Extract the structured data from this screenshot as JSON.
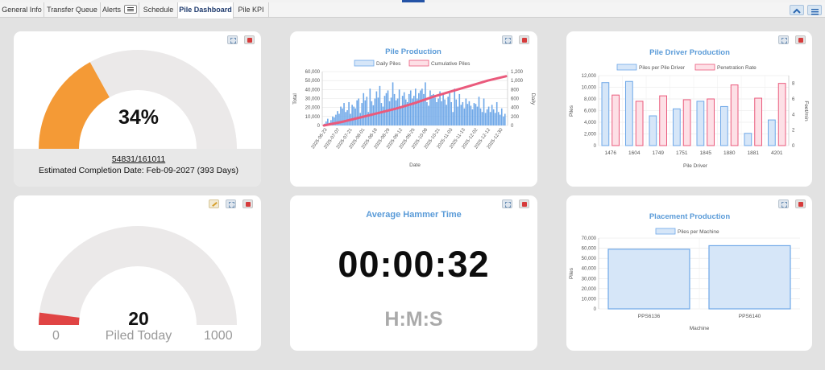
{
  "tabs": [
    {
      "label": "General Info",
      "active": false
    },
    {
      "label": "Transfer Queue",
      "active": false
    },
    {
      "label": "Alerts",
      "active": false
    },
    {
      "label": "Schedule",
      "active": false
    },
    {
      "label": "Pile Dashboard",
      "active": true
    },
    {
      "label": "Pile KPI",
      "active": false
    }
  ],
  "icons": {
    "collapse": "chevron-up-icon",
    "menu": "hamburger-menu-icon",
    "expand": "expand-icon",
    "close": "close-icon",
    "edit": "pencil-icon"
  },
  "colors": {
    "accent": "#5a9bd8",
    "gauge_fill": "#f49a36",
    "gauge_track": "#ebe9e9",
    "gauge_low": "#e04444",
    "bar_blue": "#6fa8e8",
    "bar_blue_fill": "#d6e6f8",
    "line_pink": "#ea5a7c",
    "bar_pink_fill": "#fde0e6"
  },
  "overall_progress": {
    "percent_label": "34%",
    "fraction": 0.34,
    "ratio": "54831/161011",
    "estimate": "Estimated Completion Date: Feb-09-2027 (393 Days)"
  },
  "piled_today": {
    "value": "20",
    "value_num": 20,
    "min": "0",
    "max": "1000",
    "label": "Piled Today"
  },
  "hammer_time": {
    "title": "Average Hammer Time",
    "value": "00:00:32",
    "units": "H:M:S"
  },
  "chart_data": [
    {
      "type": "bar",
      "title": "Pile Production",
      "xlabel": "Date",
      "ylabel": "Total",
      "y2label": "Daily",
      "legend": [
        "Daily Piles",
        "Cumulative Piles"
      ],
      "legend_position": "top",
      "grid": true,
      "ylim": [
        0,
        60000
      ],
      "y2lim": [
        0,
        1200
      ],
      "yticks": [
        "0",
        "10,000",
        "20,000",
        "30,000",
        "40,000",
        "50,000",
        "60,000"
      ],
      "y2ticks": [
        "0",
        "200",
        "400",
        "600",
        "800",
        "1,000",
        "1,200"
      ],
      "xticks": [
        "2025-06-23",
        "2025-07-07",
        "2025-07-21",
        "2025-08-01",
        "2025-08-18",
        "2025-08-29",
        "2025-09-12",
        "2025-09-25",
        "2025-10-08",
        "2025-10-21",
        "2025-11-03",
        "2025-11-13",
        "2025-12-02",
        "2025-12-12",
        "2025-12-30"
      ],
      "series": [
        {
          "name": "Daily Piles",
          "axis": "right",
          "values": [
            40,
            90,
            150,
            60,
            120,
            200,
            180,
            240,
            320,
            260,
            420,
            380,
            500,
            300,
            340,
            520,
            260,
            460,
            420,
            380,
            560,
            600,
            280,
            500,
            720,
            560,
            640,
            300,
            820,
            540,
            450,
            600,
            760,
            620,
            880,
            500,
            420,
            660,
            720,
            780,
            540,
            620,
            960,
            700,
            560,
            600,
            800,
            420,
            660,
            740,
            580,
            520,
            700,
            780,
            600,
            660,
            820,
            600,
            720,
            780,
            820,
            700,
            960,
            520,
            440,
            780,
            680,
            700,
            620,
            520,
            600,
            760,
            540,
            700,
            580,
            460,
            640,
            720,
            520,
            300,
            820,
            580,
            420,
            700,
            460,
            520,
            380,
            600,
            480,
            540,
            440,
            360,
            500,
            480,
            420,
            640,
            380,
            300,
            600,
            280,
            360,
            420,
            300,
            460,
            360,
            280,
            520,
            300,
            240,
            380,
            200,
            260
          ]
        },
        {
          "name": "Cumulative Piles",
          "axis": "left",
          "x": [
            0,
            0.1,
            0.2,
            0.3,
            0.4,
            0.5,
            0.6,
            0.7,
            0.8,
            0.9,
            1.0
          ],
          "values": [
            0,
            4000,
            9000,
            14000,
            19000,
            25000,
            32000,
            38000,
            44000,
            50000,
            54831
          ]
        }
      ]
    },
    {
      "type": "bar",
      "title": "Pile Driver Production",
      "xlabel": "Pile Driver",
      "ylabel": "Piles",
      "y2label": "Feet/min",
      "legend": [
        "Piles per Pile Driver",
        "Penetration Rate"
      ],
      "legend_position": "top",
      "grid": true,
      "categories": [
        "1476",
        "1604",
        "1749",
        "1751",
        "1845",
        "1880",
        "1881",
        "4201"
      ],
      "ylim": [
        0,
        12000
      ],
      "y2lim": [
        0,
        9
      ],
      "yticks": [
        "0",
        "2,000",
        "4,000",
        "6,000",
        "8,000",
        "10,000",
        "12,000"
      ],
      "y2ticks": [
        "0",
        "2",
        "4",
        "6",
        "8"
      ],
      "series": [
        {
          "name": "Piles per Pile Driver",
          "values": [
            10800,
            11000,
            5100,
            6300,
            7600,
            6700,
            2100,
            4400
          ]
        },
        {
          "name": "Penetration Rate",
          "axis": "right",
          "values": [
            6.5,
            5.7,
            6.4,
            5.9,
            6.0,
            7.8,
            6.1,
            8.0
          ]
        }
      ]
    },
    {
      "type": "bar",
      "title": "Placement Production",
      "xlabel": "Machine",
      "ylabel": "Piles",
      "legend": [
        "Piles per Machine"
      ],
      "legend_position": "top",
      "grid": true,
      "categories": [
        "PPS6136",
        "PPS6140"
      ],
      "ylim": [
        0,
        70000
      ],
      "yticks": [
        "0",
        "10,000",
        "20,000",
        "30,000",
        "40,000",
        "50,000",
        "60,000",
        "70,000"
      ],
      "series": [
        {
          "name": "Piles per Machine",
          "values": [
            59000,
            62500
          ]
        }
      ]
    }
  ]
}
